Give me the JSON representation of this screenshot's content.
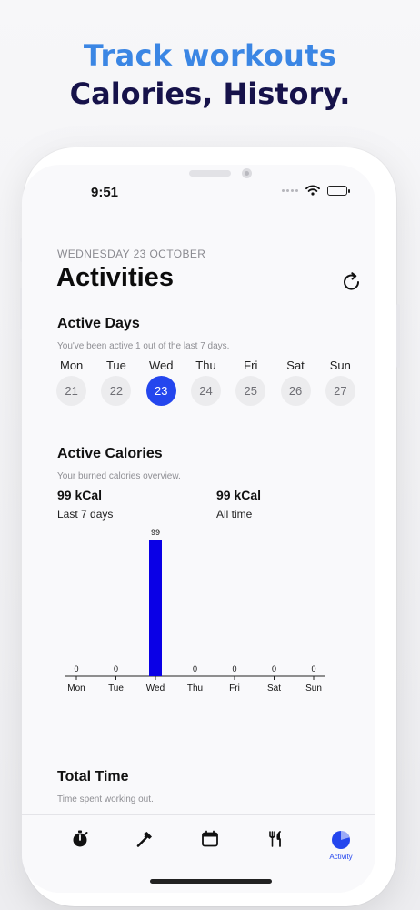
{
  "headline": {
    "line1": "Track workouts",
    "line2": "Calories, History."
  },
  "status": {
    "time": "9:51"
  },
  "header": {
    "date": "WEDNESDAY 23 OCTOBER",
    "title": "Activities"
  },
  "active_days": {
    "title": "Active Days",
    "subtitle": "You've been active 1 out of the last 7 days.",
    "days": [
      {
        "name": "Mon",
        "num": "21",
        "active": false
      },
      {
        "name": "Tue",
        "num": "22",
        "active": false
      },
      {
        "name": "Wed",
        "num": "23",
        "active": true
      },
      {
        "name": "Thu",
        "num": "24",
        "active": false
      },
      {
        "name": "Fri",
        "num": "25",
        "active": false
      },
      {
        "name": "Sat",
        "num": "26",
        "active": false
      },
      {
        "name": "Sun",
        "num": "27",
        "active": false
      }
    ]
  },
  "active_calories": {
    "title": "Active Calories",
    "subtitle": "Your burned calories overview.",
    "last7_value": "99 kCal",
    "last7_label": "Last 7 days",
    "all_value": "99 kCal",
    "all_label": "All time"
  },
  "chart_data": {
    "type": "bar",
    "categories": [
      "Mon",
      "Tue",
      "Wed",
      "Thu",
      "Fri",
      "Sat",
      "Sun"
    ],
    "values": [
      0,
      0,
      99,
      0,
      0,
      0,
      0
    ],
    "title": "",
    "xlabel": "",
    "ylabel": "",
    "ylim": [
      0,
      99
    ],
    "grid": false,
    "bar_color": "#0a00e6"
  },
  "total_time": {
    "title": "Total Time",
    "subtitle": "Time spent working out."
  },
  "tabbar": {
    "active_label": "Activity",
    "accent": "#2446ee",
    "icons": [
      "stopwatch-icon",
      "hammer-icon",
      "calendar-icon",
      "fork-knife-icon",
      "pie-chart-icon"
    ]
  }
}
